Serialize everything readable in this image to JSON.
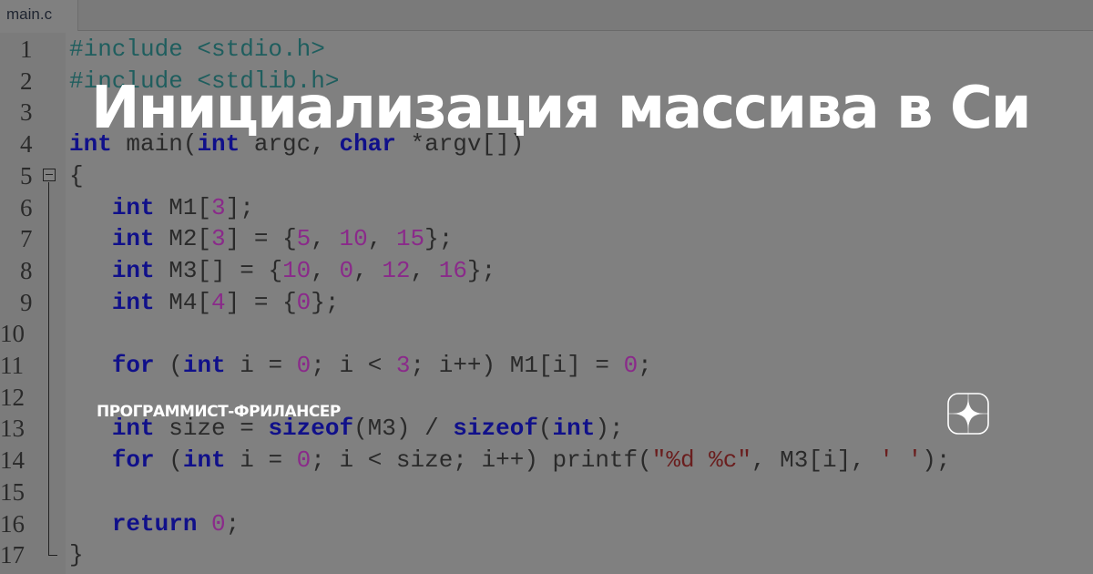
{
  "editor": {
    "tab_label": "main.c",
    "lines": [
      {
        "n": "1",
        "html": "<span class='pp'>#include &lt;stdio.h&gt;</span>"
      },
      {
        "n": "2",
        "html": "<span class='pp'>#include &lt;stdlib.h&gt;</span>"
      },
      {
        "n": "3",
        "html": ""
      },
      {
        "n": "4",
        "html": "<span class='kw'>int</span> main(<span class='kw'>int</span> argc, <span class='kw'>char</span> *argv[])"
      },
      {
        "n": "5",
        "html": "{"
      },
      {
        "n": "6",
        "html": "  <span class='kw'>int</span> M1[<span class='num'>3</span>];"
      },
      {
        "n": "7",
        "html": "  <span class='kw'>int</span> M2[<span class='num'>3</span>] = {<span class='num'>5</span>, <span class='num'>10</span>, <span class='num'>15</span>};"
      },
      {
        "n": "8",
        "html": "  <span class='kw'>int</span> M3[] = {<span class='num'>10</span>, <span class='num'>0</span>, <span class='num'>12</span>, <span class='num'>16</span>};"
      },
      {
        "n": "9",
        "html": "  <span class='kw'>int</span> M4[<span class='num'>4</span>] = {<span class='num'>0</span>};"
      },
      {
        "n": "10",
        "html": ""
      },
      {
        "n": "11",
        "html": "  <span class='kw'>for</span> (<span class='kw'>int</span> i = <span class='num'>0</span>; i &lt; <span class='num'>3</span>; i++) M1[i] = <span class='num'>0</span>;"
      },
      {
        "n": "12",
        "html": ""
      },
      {
        "n": "13",
        "html": "  <span class='kw'>int</span> size = <span class='kw'>sizeof</span>(M3) / <span class='kw'>sizeof</span>(<span class='kw'>int</span>);"
      },
      {
        "n": "14",
        "html": "  <span class='kw'>for</span> (<span class='kw'>int</span> i = <span class='num'>0</span>; i &lt; size; i++) printf(<span class='str'>\"%d %c\"</span>, M3[i], <span class='str'>' '</span>);"
      },
      {
        "n": "15",
        "html": ""
      },
      {
        "n": "16",
        "html": "  <span class='kw'>return</span> <span class='num'>0</span>;"
      },
      {
        "n": "17",
        "html": "}"
      }
    ]
  },
  "overlay": {
    "title": "Инициализация массива в Си",
    "author": "ПРОГРАММИСТ-ФРИЛАНСЕР",
    "logo_icon": "dzen-star-icon"
  },
  "colors": {
    "keyword": "#10108a",
    "preprocessor": "#1f5e5e",
    "number": "#8a2a8a",
    "string": "#6a1e1e"
  }
}
